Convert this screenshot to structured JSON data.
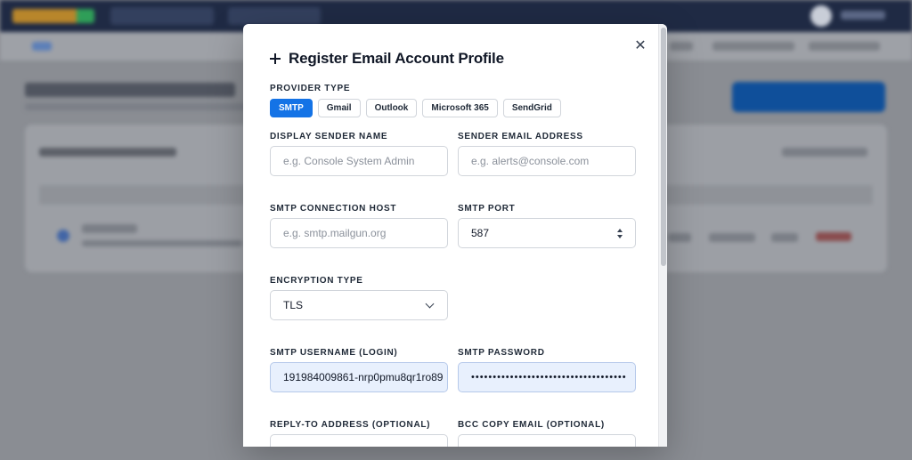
{
  "modal": {
    "title": "Register Email Account Profile",
    "close_icon": "close-icon",
    "provider_type": {
      "label": "PROVIDER TYPE",
      "options": [
        "SMTP",
        "Gmail",
        "Outlook",
        "Microsoft 365",
        "SendGrid"
      ],
      "selected": "SMTP"
    },
    "display_sender_name": {
      "label": "DISPLAY SENDER NAME",
      "placeholder": "e.g. Console System Admin"
    },
    "sender_email": {
      "label": "SENDER EMAIL ADDRESS",
      "placeholder": "e.g. alerts@console.com"
    },
    "smtp_host": {
      "label": "SMTP CONNECTION HOST",
      "placeholder": "e.g. smtp.mailgun.org"
    },
    "smtp_port": {
      "label": "SMTP PORT",
      "value": "587"
    },
    "encryption_type": {
      "label": "ENCRYPTION TYPE",
      "value": "TLS"
    },
    "smtp_username": {
      "label": "SMTP USERNAME (LOGIN)",
      "value": "191984009861-nrp0pmu8qr1ro89"
    },
    "smtp_password": {
      "label": "SMTP PASSWORD",
      "value": "••••••••••••••••••••••••••••••••••••"
    },
    "reply_to": {
      "label": "REPLY-TO ADDRESS (OPTIONAL)"
    },
    "bcc_copy": {
      "label": "BCC COPY EMAIL (OPTIONAL)"
    }
  },
  "colors": {
    "accent": "#1473e6",
    "filled_field": "#e8f0fd"
  }
}
